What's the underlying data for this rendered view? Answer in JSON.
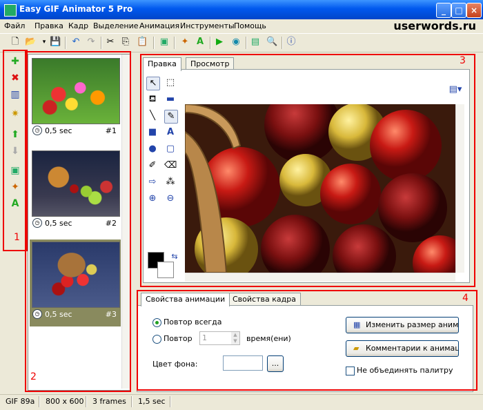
{
  "window": {
    "title": "Easy GIF Animator 5 Pro"
  },
  "menu": [
    "Файл",
    "Правка",
    "Кадр",
    "Выделение",
    "Анимация",
    "Инструменты",
    "Помощь"
  ],
  "brand": "userwords.ru",
  "annotations": [
    "1",
    "2",
    "3",
    "4"
  ],
  "frames": [
    {
      "delay": "0,5 sec",
      "number": "#1",
      "selected": false
    },
    {
      "delay": "0,5 sec",
      "number": "#2",
      "selected": false
    },
    {
      "delay": "0,5 sec",
      "number": "#3",
      "selected": true
    }
  ],
  "editor": {
    "tabs": [
      "Правка",
      "Просмотр"
    ],
    "active_tab": "Правка"
  },
  "props": {
    "tabs": [
      "Свойства анимации",
      "Свойства кадра"
    ],
    "repeat_forever": "Повтор всегда",
    "repeat": "Повтор",
    "repeat_count": "1",
    "times": "время(ени)",
    "bg_color": "Цвет фона:",
    "browse": "...",
    "resize_button": "Изменить размер анимации",
    "comments_button": "Комментарии к анимации",
    "no_merge_palette": "Не объединять палитру"
  },
  "status": [
    "GIF 89a",
    "800 x 600",
    "3 frames",
    "1,5 sec"
  ],
  "colors": {
    "titlebar": "#0058ee",
    "annotation_red": "#e00000",
    "selected_frame": "#898a5e"
  }
}
